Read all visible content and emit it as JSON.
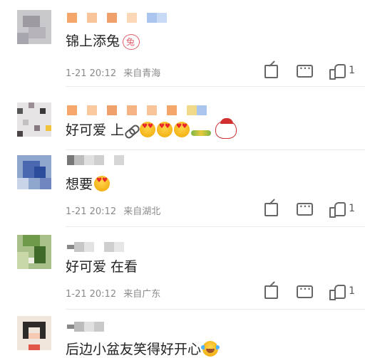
{
  "comments": [
    {
      "text": "锦上添兔",
      "time": "1-21 20:12",
      "location": "来自青海",
      "likes": "1",
      "emojis": [
        "rabbit-sticker"
      ]
    },
    {
      "text": "好可爱 上",
      "time": "",
      "location": "",
      "likes": "",
      "emojis": [
        "link-icon",
        "heart-eyes",
        "heart-eyes",
        "heart-eyes",
        "christmas-sticker"
      ]
    },
    {
      "text": "想要",
      "time": "1-21 20:12",
      "location": "来自湖北",
      "likes": "1",
      "emojis": [
        "heart-eyes"
      ]
    },
    {
      "text": "好可爱 在看",
      "time": "1-21 20:12",
      "location": "来自广东",
      "likes": "1",
      "emojis": []
    },
    {
      "text": "后边小盆友笑得好开心",
      "time": "",
      "location": "",
      "likes": "",
      "emojis": [
        "laugh-cry"
      ]
    }
  ],
  "colors": {
    "meta_text": "#8a8a8a",
    "body_text": "#222222",
    "icon": "#666666"
  }
}
